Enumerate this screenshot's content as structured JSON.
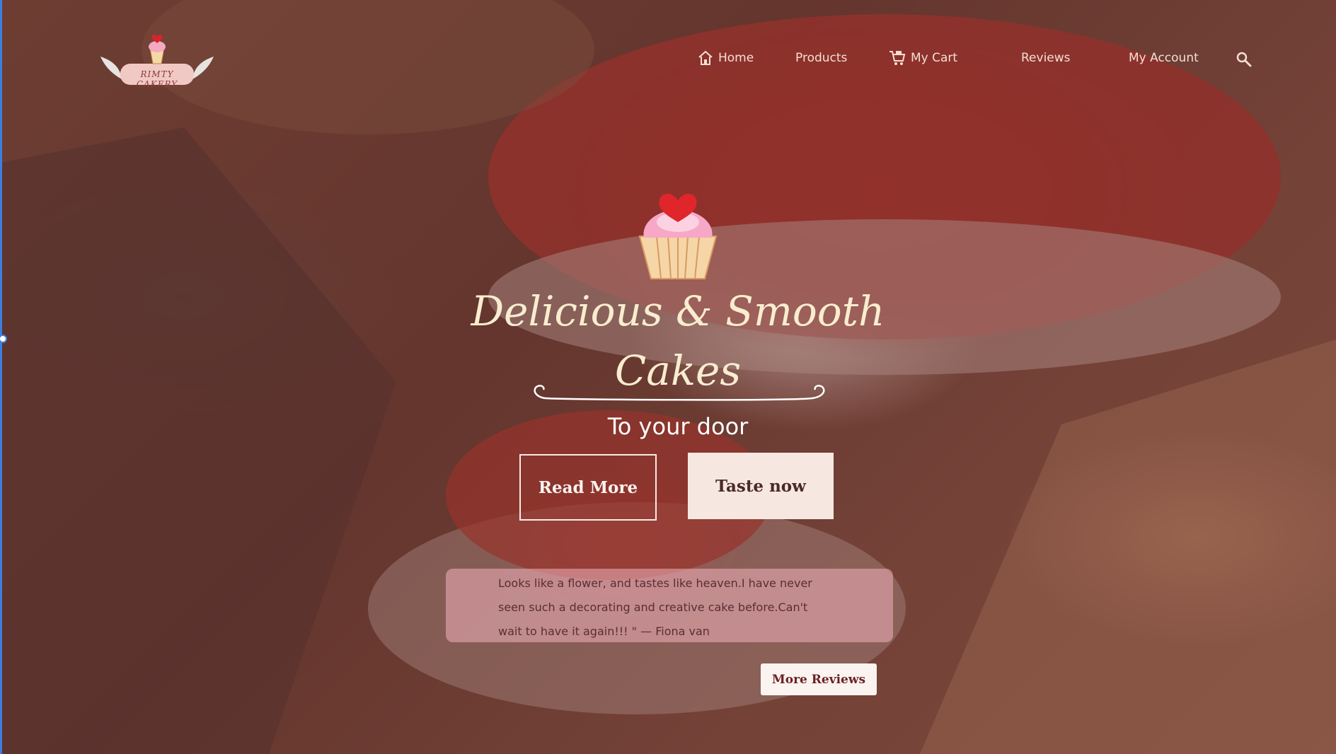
{
  "brand": {
    "logo_text": "RIMTY CAKERY"
  },
  "nav": {
    "home": "Home",
    "products": "Products",
    "cart": "My Cart",
    "reviews": "Reviews",
    "account": "My Account"
  },
  "hero": {
    "title_line1": "Delicious & Smooth",
    "title_line2": "Cakes",
    "subtitle": "To your door",
    "read_more": "Read More",
    "taste_now": "Taste now"
  },
  "review": {
    "text": "Looks like a flower, and tastes like heaven.I have never seen such a decorating and creative cake before.Can't wait to have it again!!! \" — Fiona van",
    "more_button": "More Reviews"
  },
  "icons": {
    "home": "home-icon",
    "cart": "cart-icon",
    "search": "search-icon",
    "cupcake": "cupcake-icon"
  },
  "colors": {
    "overlay": "#6e322d",
    "title": "#f8edcf",
    "button_light": "#f6e8e0",
    "review_card": "#f2b2be",
    "accent_heart": "#e0262b"
  }
}
